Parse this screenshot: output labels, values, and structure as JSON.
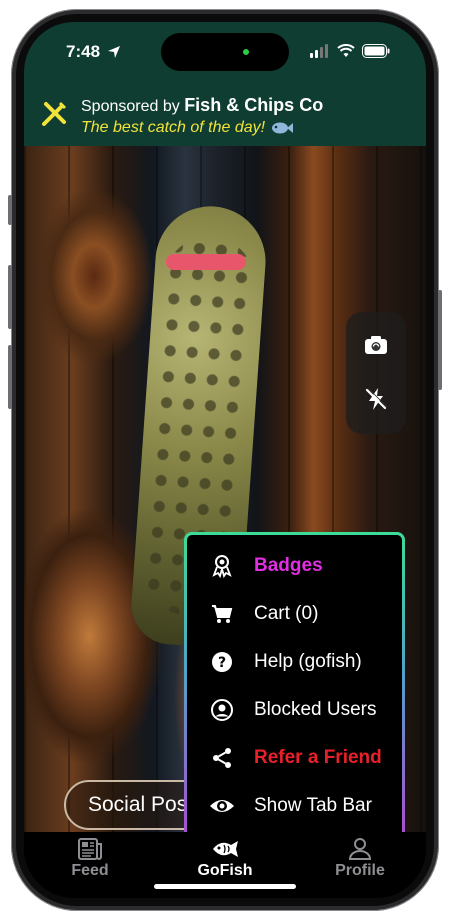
{
  "status_bar": {
    "time": "7:48"
  },
  "sponsor": {
    "prefix": "Sponsored by ",
    "brand": "Fish & Chips Co",
    "tagline": "The best catch of the day!"
  },
  "camera": {
    "social_post_label": "Social Pos"
  },
  "menu": {
    "items": [
      {
        "label": "Badges",
        "color": "#e02ee0",
        "icon": "badge-icon"
      },
      {
        "label": "Cart (0)",
        "color": "#ffffff",
        "icon": "cart-icon"
      },
      {
        "label": "Help (gofish)",
        "color": "#ffffff",
        "icon": "help-icon"
      },
      {
        "label": "Blocked Users",
        "color": "#ffffff",
        "icon": "user-circle-icon"
      },
      {
        "label": "Refer a Friend",
        "color": "#e8202a",
        "icon": "share-icon"
      },
      {
        "label": "Show Tab Bar",
        "color": "#ffffff",
        "icon": "eye-icon"
      }
    ]
  },
  "tabbar": {
    "tabs": [
      {
        "label": "Feed",
        "icon": "newspaper-icon",
        "active": false
      },
      {
        "label": "GoFish",
        "icon": "fish-icon",
        "active": true
      },
      {
        "label": "Profile",
        "icon": "person-icon",
        "active": false
      }
    ]
  },
  "colors": {
    "header_green": "#0f3d32",
    "tagline_yellow": "#f2e33b",
    "shutter_ring": "#f1e24a",
    "badges_magenta": "#e02ee0",
    "refer_red": "#e8202a"
  }
}
